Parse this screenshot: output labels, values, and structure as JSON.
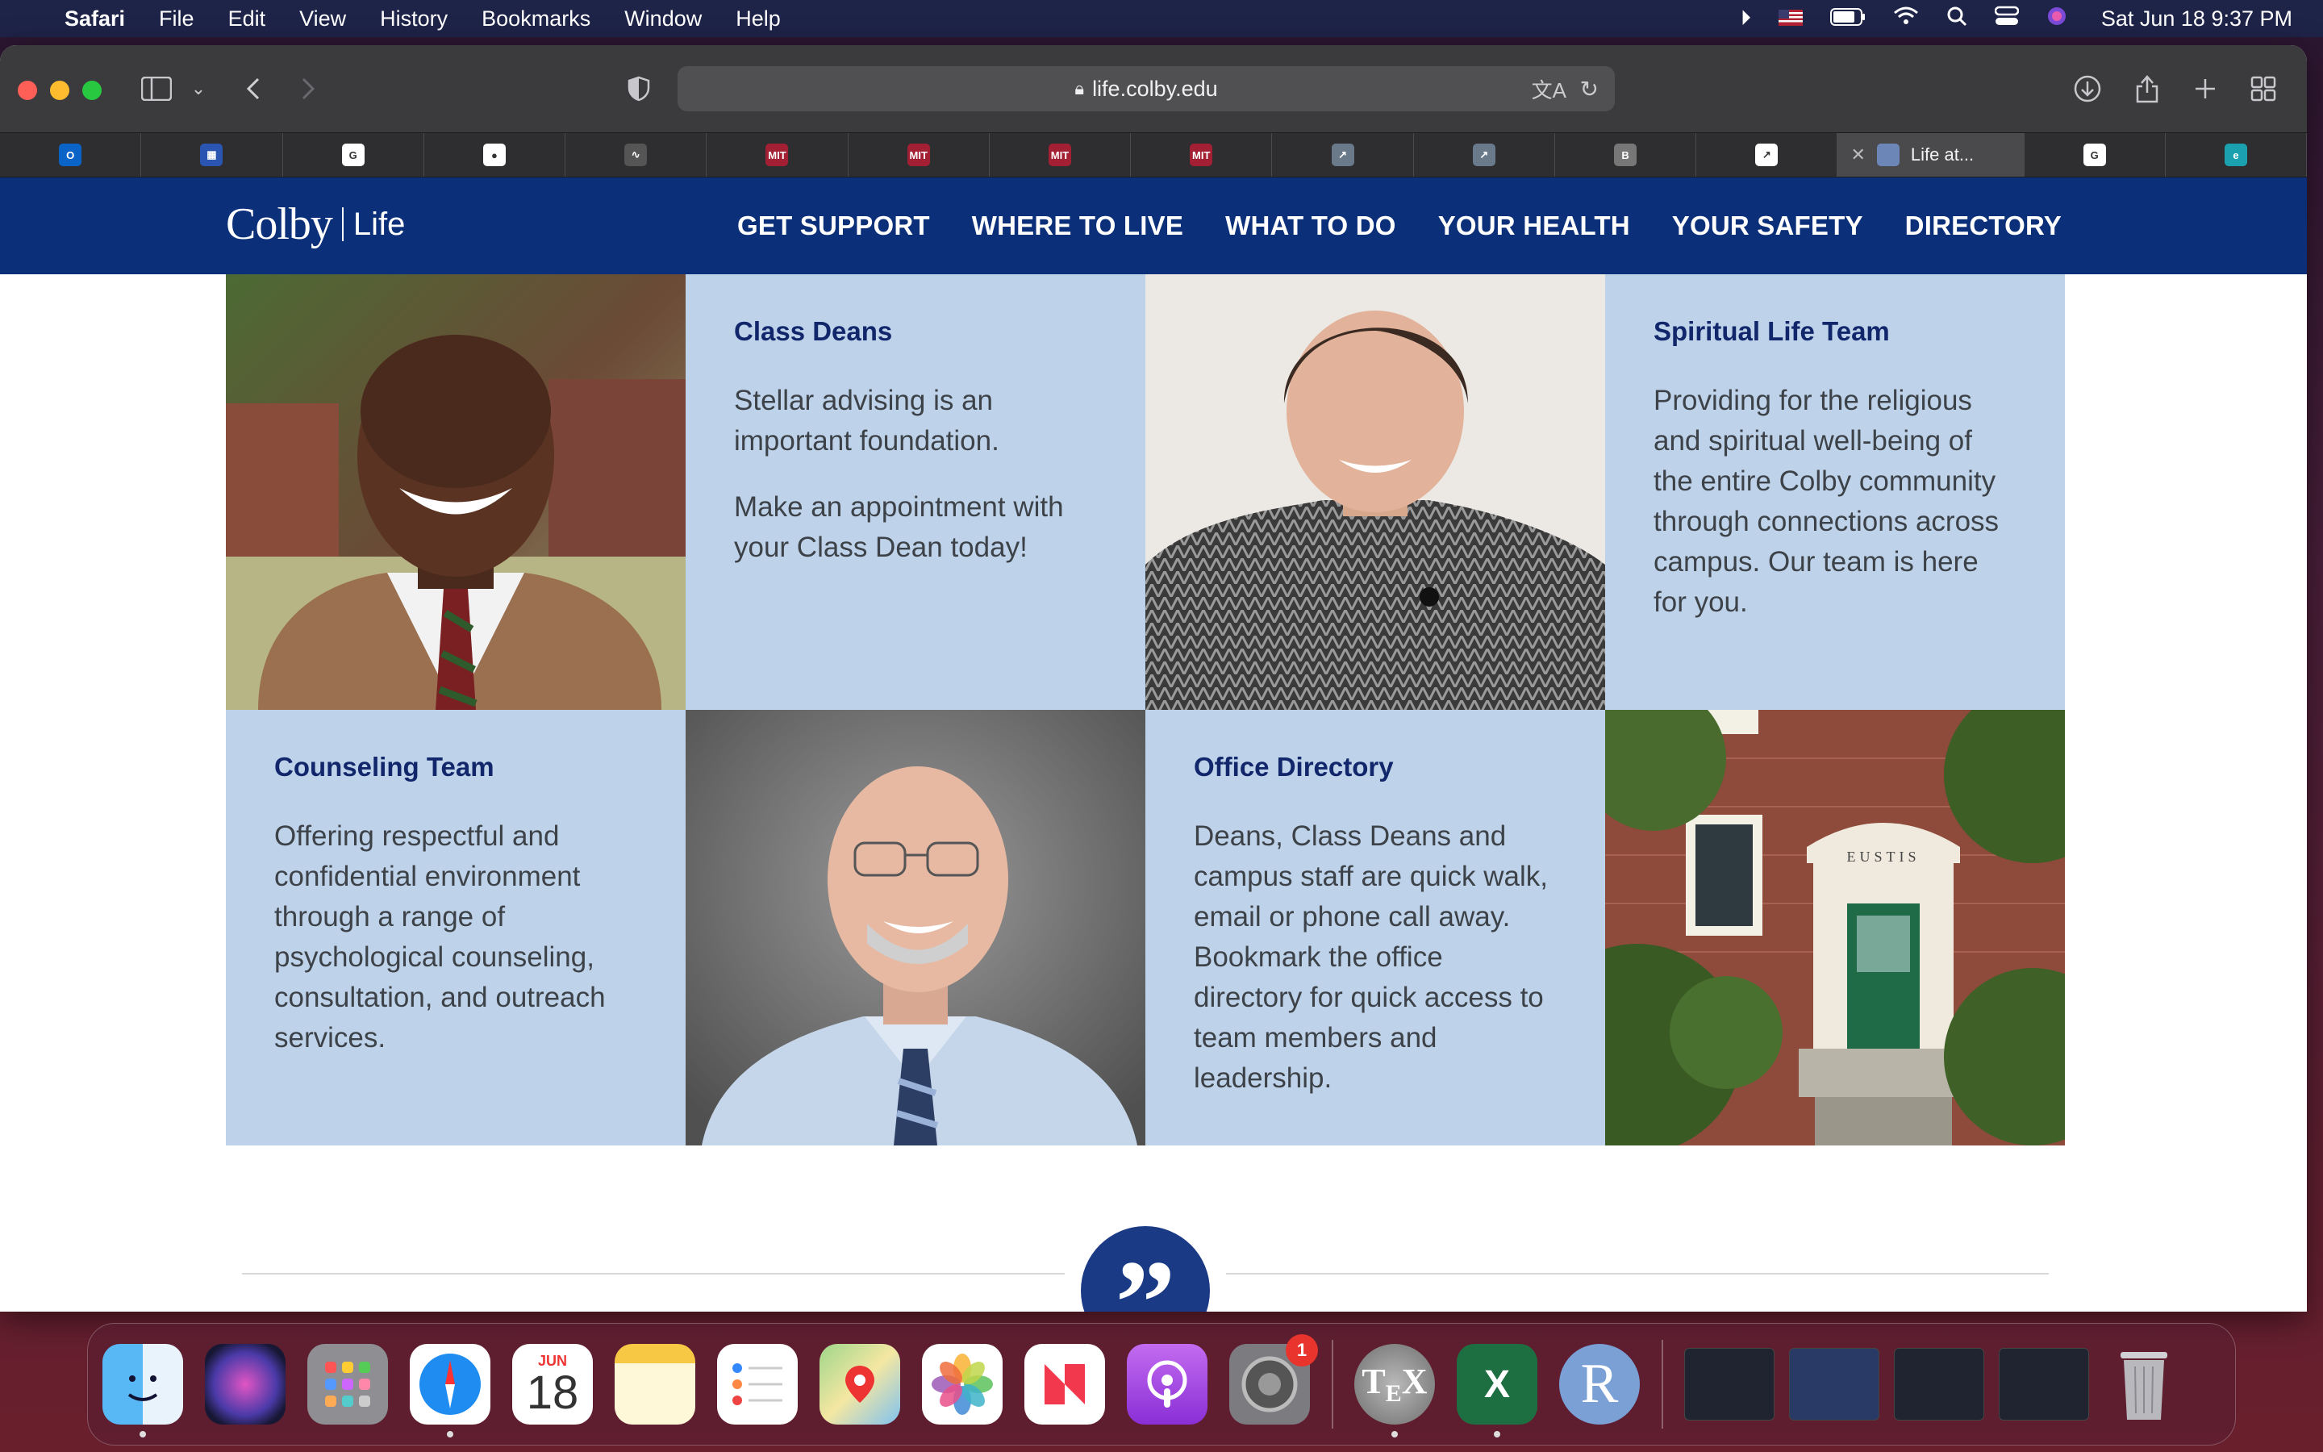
{
  "menubar": {
    "app": "Safari",
    "items": [
      "File",
      "Edit",
      "View",
      "History",
      "Bookmarks",
      "Window",
      "Help"
    ],
    "clock": "Sat Jun 18  9:37 PM"
  },
  "browser": {
    "url": "life.colby.edu",
    "active_tab_title": "Life at...",
    "tabs": [
      {
        "icon": "outlook-icon",
        "glyph": "O",
        "color": "#0a64c8"
      },
      {
        "icon": "calendar-app-icon",
        "glyph": "▦",
        "color": "#2a55b0"
      },
      {
        "icon": "google-icon",
        "glyph": "G",
        "color": "#ffffff"
      },
      {
        "icon": "github-icon",
        "glyph": "●",
        "color": "#ffffff"
      },
      {
        "icon": "activity-icon",
        "glyph": "∿",
        "color": "#555555"
      },
      {
        "icon": "mit-ocw-icon",
        "glyph": "MIT",
        "color": "#a31f34"
      },
      {
        "icon": "mit-ocw-icon",
        "glyph": "MIT",
        "color": "#a31f34"
      },
      {
        "icon": "mit-ocw-icon",
        "glyph": "MIT",
        "color": "#a31f34"
      },
      {
        "icon": "mit-ocw-icon",
        "glyph": "MIT",
        "color": "#a31f34"
      },
      {
        "icon": "chart-icon",
        "glyph": "↗",
        "color": "#6a7a8a"
      },
      {
        "icon": "chart-icon",
        "glyph": "↗",
        "color": "#6a7a8a"
      },
      {
        "icon": "b-icon",
        "glyph": "B",
        "color": "#777777"
      },
      {
        "icon": "graph-icon",
        "glyph": "↗",
        "color": "#ffffff"
      }
    ],
    "tabs_after": [
      {
        "icon": "google-icon",
        "glyph": "G",
        "color": "#ffffff"
      },
      {
        "icon": "link-icon",
        "glyph": "e",
        "color": "#1ba0b0"
      }
    ]
  },
  "site": {
    "logo_main": "Colby",
    "logo_sub": "Life",
    "nav": [
      "GET SUPPORT",
      "WHERE TO LIVE",
      "WHAT TO DO",
      "YOUR HEALTH",
      "YOUR SAFETY",
      "DIRECTORY"
    ]
  },
  "cards": {
    "class_deans": {
      "title": "Class Deans",
      "p1": "Stellar advising is an important foundation.",
      "p2": "Make an appointment with your Class Dean today!"
    },
    "spiritual": {
      "title": "Spiritual Life Team",
      "p1": "Providing for the religious and spiritual well-being of the entire Colby community through connections across campus. Our team is here for you."
    },
    "counseling": {
      "title": "Counseling Team",
      "p1": "Offering respectful and confidential environment through a range of psychological counseling, consultation, and outreach services."
    },
    "directory": {
      "title": "Office Directory",
      "p1": "Deans, Class Deans and campus staff are quick walk, email or phone call away. Bookmark the office directory for quick access to team members and leadership."
    }
  },
  "building_sign": "EUSTIS",
  "dock": {
    "calendar_month": "JUN",
    "calendar_day": "18",
    "settings_badge": "1"
  }
}
